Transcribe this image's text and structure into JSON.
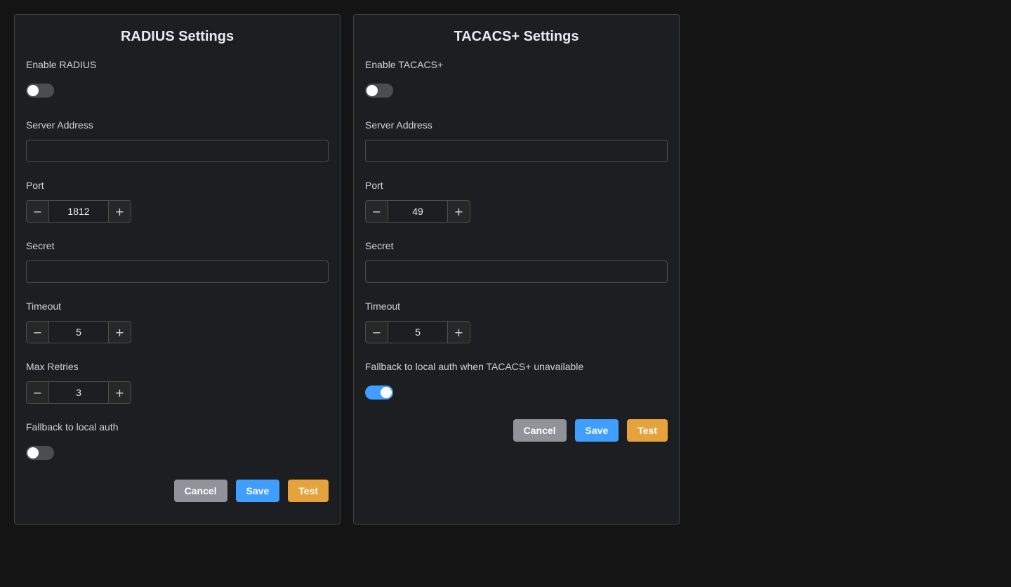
{
  "colors": {
    "page_background": "#141414",
    "panel_background": "#1d1e21",
    "toggle_on": "#409eff",
    "toggle_off": "#4c4d4f",
    "cancel_button": "#909399",
    "save_button": "#409eff",
    "test_button": "#e6a23c"
  },
  "radius": {
    "title": "RADIUS Settings",
    "enable_label": "Enable RADIUS",
    "enabled": false,
    "server_address_label": "Server Address",
    "server_address_value": "",
    "port_label": "Port",
    "port_value": "1812",
    "secret_label": "Secret",
    "secret_value": "",
    "timeout_label": "Timeout",
    "timeout_value": "5",
    "max_retries_label": "Max Retries",
    "max_retries_value": "3",
    "fallback_label": "Fallback to local auth",
    "fallback_enabled": false,
    "cancel_label": "Cancel",
    "save_label": "Save",
    "test_label": "Test"
  },
  "tacacs": {
    "title": "TACACS+ Settings",
    "enable_label": "Enable TACACS+",
    "enabled": false,
    "server_address_label": "Server Address",
    "server_address_value": "",
    "port_label": "Port",
    "port_value": "49",
    "secret_label": "Secret",
    "secret_value": "",
    "timeout_label": "Timeout",
    "timeout_value": "5",
    "fallback_label": "Fallback to local auth when TACACS+ unavailable",
    "fallback_enabled": true,
    "cancel_label": "Cancel",
    "save_label": "Save",
    "test_label": "Test"
  },
  "icons": {
    "decrement": "minus-icon",
    "increment": "plus-icon"
  }
}
